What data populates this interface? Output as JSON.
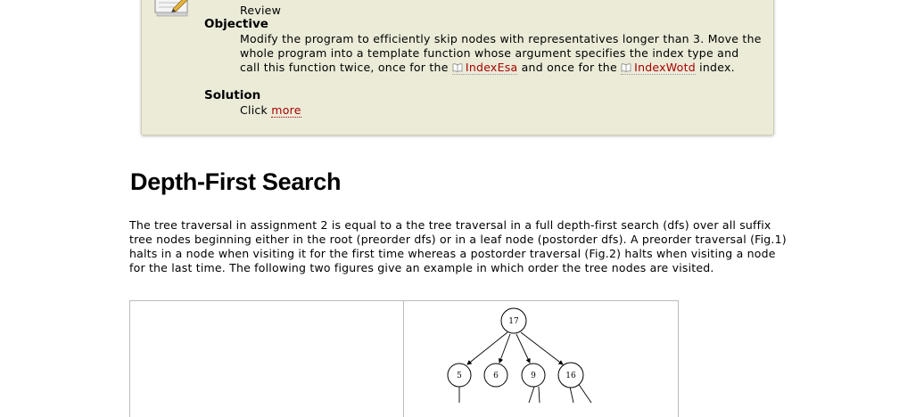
{
  "assignment": {
    "type_value": "Review",
    "objective_label": "Objective",
    "objective_text_1": "Modify the program to efficiently skip nodes with representatives longer than 3. Move the whole program into a template function whose argument specifies the index type and call this function twice, once for the",
    "link_index_esa": "IndexEsa",
    "objective_text_2": "and once for the",
    "link_index_wotd": "IndexWotd",
    "objective_text_3": "index.",
    "solution_label": "Solution",
    "solution_text": "Click",
    "solution_link": "more"
  },
  "section": {
    "title": "Depth-First Search",
    "paragraph": "The tree traversal in assignment 2 is equal to a the tree traversal in a full depth-first search (dfs) over all suffix tree nodes beginning either in the root (preorder dfs) or in a leaf node (postorder dfs). A preorder traversal (Fig.1) halts in a node when visiting it for the first time whereas a postorder traversal (Fig.2) halts when visiting a node for the last time. The following two figures give an example in which order the tree nodes are visited."
  },
  "figure": {
    "root_label": "17",
    "child_labels": [
      "5",
      "6",
      "9",
      "16"
    ]
  },
  "colors": {
    "box_background": "#ebebd8",
    "link": "#a80000"
  },
  "icons": [
    "notepad-icon",
    "book-icon"
  ]
}
